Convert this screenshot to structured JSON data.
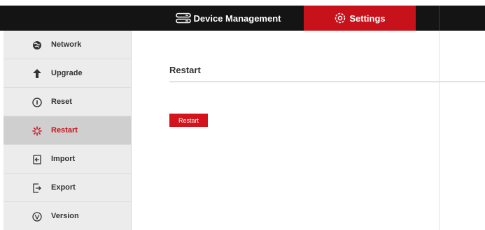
{
  "header": {
    "tabs": [
      {
        "label": "Device Management",
        "icon": "server-stack-icon"
      },
      {
        "label": "Settings",
        "icon": "gear-icon",
        "active": true
      }
    ],
    "active_color": "#c8121b"
  },
  "sidebar": {
    "items": [
      {
        "label": "Network",
        "icon": "globe-icon"
      },
      {
        "label": "Upgrade",
        "icon": "arrow-up-icon"
      },
      {
        "label": "Reset",
        "icon": "info-circle-icon"
      },
      {
        "label": "Restart",
        "icon": "spinner-icon",
        "active": true
      },
      {
        "label": "Import",
        "icon": "import-icon"
      },
      {
        "label": "Export",
        "icon": "export-icon"
      },
      {
        "label": "Version",
        "icon": "version-icon"
      }
    ]
  },
  "main": {
    "title": "Restart",
    "button_label": "Restart"
  }
}
